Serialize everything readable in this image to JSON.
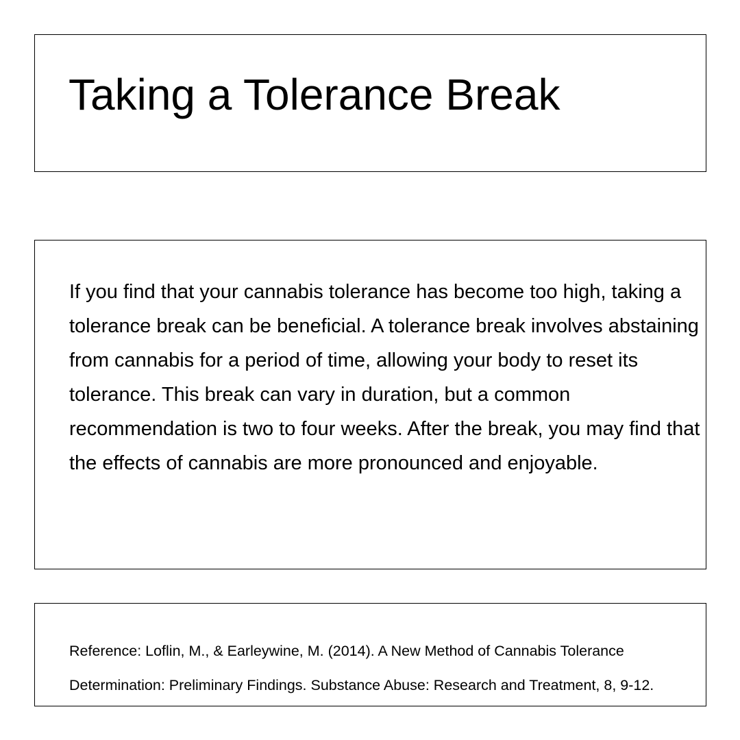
{
  "title": "Taking a Tolerance Break",
  "body": {
    "paragraph": "If you find that your cannabis tolerance has become too high, taking a tolerance break can be beneficial. A tolerance break involves abstaining from cannabis for a period of time, allowing your body to reset its tolerance. This break can vary in duration, but a common recommendation is two to four weeks. After the break, you may find that the effects of cannabis are more pronounced and enjoyable."
  },
  "reference": {
    "text": "Reference: Loflin, M., & Earleywine, M. (2014). A New Method of Cannabis Tolerance Determination: Preliminary Findings. Substance Abuse: Research and Treatment, 8, 9-12."
  },
  "colors": {
    "background": "#ffffff",
    "text": "#000000",
    "border": "#000000"
  }
}
